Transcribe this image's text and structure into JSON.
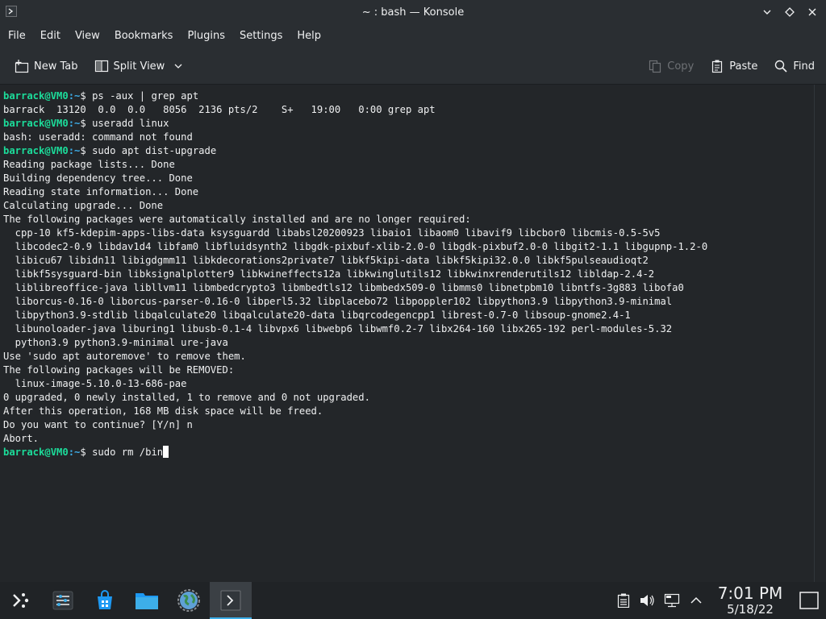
{
  "window": {
    "title": "~ : bash — Konsole"
  },
  "menubar": {
    "items": [
      "File",
      "Edit",
      "View",
      "Bookmarks",
      "Plugins",
      "Settings",
      "Help"
    ]
  },
  "toolbar": {
    "new_tab_label": "New Tab",
    "split_view_label": "Split View",
    "copy_label": "Copy",
    "paste_label": "Paste",
    "find_label": "Find"
  },
  "terminal": {
    "lines": [
      {
        "user": "barrack@VM0",
        "path": ":~",
        "cmd": "$ ps -aux | grep apt"
      },
      {
        "text": "barrack  13120  0.0  0.0   8056  2136 pts/2    S+   19:00   0:00 grep apt"
      },
      {
        "user": "barrack@VM0",
        "path": ":~",
        "cmd": "$ useradd linux"
      },
      {
        "text": "bash: useradd: command not found"
      },
      {
        "user": "barrack@VM0",
        "path": ":~",
        "cmd": "$ sudo apt dist-upgrade"
      },
      {
        "text": "Reading package lists... Done"
      },
      {
        "text": "Building dependency tree... Done"
      },
      {
        "text": "Reading state information... Done"
      },
      {
        "text": "Calculating upgrade... Done"
      },
      {
        "text": "The following packages were automatically installed and are no longer required:"
      },
      {
        "text": "  cpp-10 kf5-kdepim-apps-libs-data ksysguardd libabsl20200923 libaio1 libaom0 libavif9 libcbor0 libcmis-0.5-5v5"
      },
      {
        "text": "  libcodec2-0.9 libdav1d4 libfam0 libfluidsynth2 libgdk-pixbuf-xlib-2.0-0 libgdk-pixbuf2.0-0 libgit2-1.1 libgupnp-1.2-0"
      },
      {
        "text": "  libicu67 libidn11 libigdgmm11 libkdecorations2private7 libkf5kipi-data libkf5kipi32.0.0 libkf5pulseaudioqt2"
      },
      {
        "text": "  libkf5sysguard-bin libksignalplotter9 libkwineffects12a libkwinglutils12 libkwinxrenderutils12 libldap-2.4-2"
      },
      {
        "text": "  liblibreoffice-java libllvm11 libmbedcrypto3 libmbedtls12 libmbedx509-0 libmms0 libnetpbm10 libntfs-3g883 libofa0"
      },
      {
        "text": "  liborcus-0.16-0 liborcus-parser-0.16-0 libperl5.32 libplacebo72 libpoppler102 libpython3.9 libpython3.9-minimal"
      },
      {
        "text": "  libpython3.9-stdlib libqalculate20 libqalculate20-data libqrcodegencpp1 librest-0.7-0 libsoup-gnome2.4-1"
      },
      {
        "text": "  libunoloader-java liburing1 libusb-0.1-4 libvpx6 libwebp6 libwmf0.2-7 libx264-160 libx265-192 perl-modules-5.32"
      },
      {
        "text": "  python3.9 python3.9-minimal ure-java"
      },
      {
        "text": "Use 'sudo apt autoremove' to remove them."
      },
      {
        "text": "The following packages will be REMOVED:"
      },
      {
        "text": "  linux-image-5.10.0-13-686-pae"
      },
      {
        "text": "0 upgraded, 0 newly installed, 1 to remove and 0 not upgraded."
      },
      {
        "text": "After this operation, 168 MB disk space will be freed."
      },
      {
        "text": "Do you want to continue? [Y/n] n"
      },
      {
        "text": "Abort."
      },
      {
        "user": "barrack@VM0",
        "path": ":~",
        "cmd": "$ sudo rm /bin",
        "cursor": true
      }
    ]
  },
  "taskbar": {
    "apps": [
      {
        "icon": "application-launcher-icon",
        "active": false
      },
      {
        "icon": "system-settings-icon",
        "active": false
      },
      {
        "icon": "discover-store-icon",
        "active": false
      },
      {
        "icon": "file-manager-icon",
        "active": false
      },
      {
        "icon": "web-browser-icon",
        "active": false
      },
      {
        "icon": "konsole-icon",
        "active": true
      }
    ],
    "tray_icons": [
      "clipboard-icon",
      "volume-icon",
      "network-icon",
      "expand-tray-icon"
    ],
    "clock_time": "7:01 PM",
    "clock_date": "5/18/22"
  },
  "colors": {
    "prompt_user": "#1cdc9a",
    "prompt_path": "#3daee9",
    "accent": "#3daee9"
  }
}
